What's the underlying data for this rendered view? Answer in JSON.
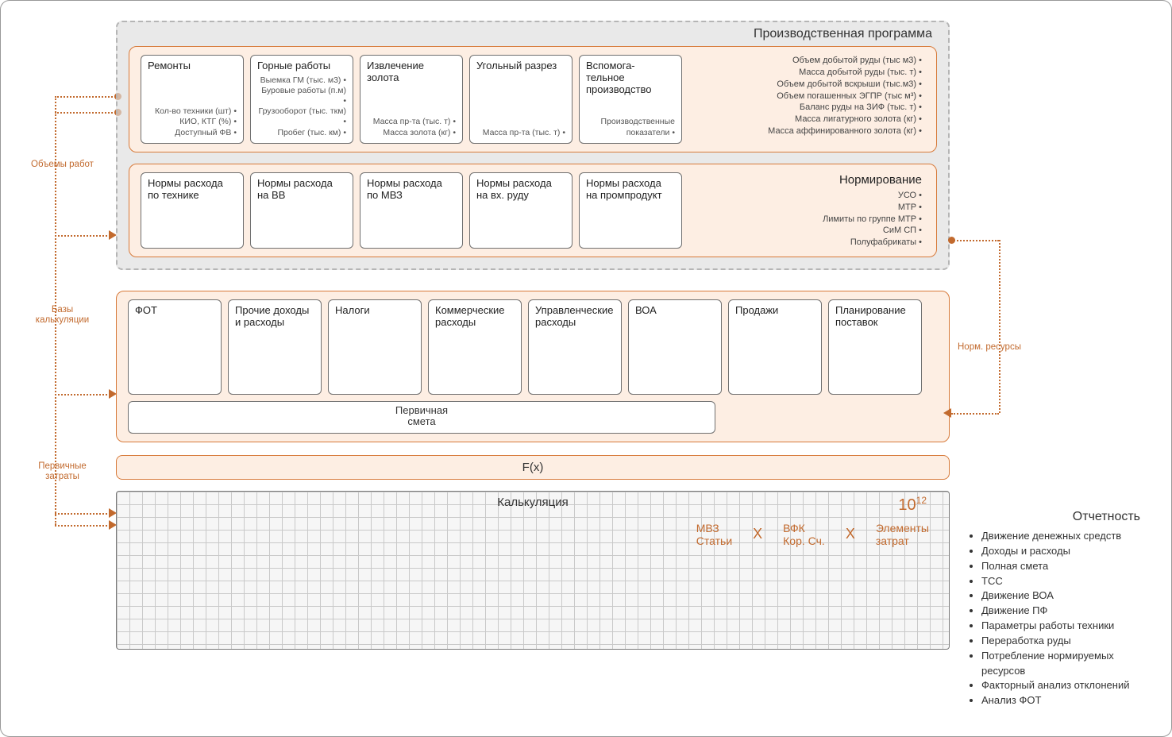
{
  "grey_title": "Производственная программа",
  "row1": {
    "cards": [
      {
        "title": "Ремонты",
        "bullets": [
          "Кол-во техники (шт)",
          "КИО, КТГ (%)",
          "Доступный ФВ"
        ]
      },
      {
        "title": "Горные работы",
        "bullets": [
          "Выемка ГМ (тыс. м3)",
          "Буровые работы (п.м)",
          "Грузооборот (тыс. ткм)",
          "Пробег (тыс. км)"
        ]
      },
      {
        "title": "Извлечение золота",
        "bullets": [
          "Масса пр-та (тыс. т)",
          "Масса золота (кг)"
        ]
      },
      {
        "title": "Угольный разрез",
        "bullets": [
          "Масса пр-та (тыс. т)"
        ]
      },
      {
        "title": "Вспомога-\nтельное производство",
        "bullets": [
          "Производственные показатели"
        ]
      }
    ],
    "aux": [
      "Объем добытой руды (тыс м3)",
      "Масса добытой руды (тыс. т)",
      "Объем добытой вскрыши (тыс.м3)",
      "Объем погашенных ЭГПР (тыс м³)",
      "Баланс руды на ЗИФ (тыс. т)",
      "Масса лигатурного золота (кг)",
      "Масса аффинированного золота (кг)"
    ]
  },
  "row2": {
    "cards": [
      {
        "title": "Нормы расхода по технике"
      },
      {
        "title": "Нормы расхода на ВВ"
      },
      {
        "title": "Нормы расхода по МВЗ"
      },
      {
        "title": "Нормы расхода на вх. руду"
      },
      {
        "title": "Нормы расхода на промпродукт"
      }
    ],
    "aux_title": "Нормирование",
    "aux": [
      "УСО",
      "МТР",
      "Лимиты по группе МТР",
      "СиМ СП",
      "Полуфабрикаты"
    ]
  },
  "row3": {
    "cards": [
      {
        "title": "ФОТ"
      },
      {
        "title": "Прочие доходы и расходы"
      },
      {
        "title": "Налоги"
      },
      {
        "title": "Коммерческие расходы"
      },
      {
        "title": "Управленческие расходы"
      },
      {
        "title": "ВОА"
      },
      {
        "title": "Продажи"
      },
      {
        "title": "Планирование поставок"
      }
    ],
    "primary_l1": "Первичная",
    "primary_l2": "смета"
  },
  "fx_label": "F(x)",
  "calc": {
    "title": "Калькуляция",
    "ten": "10",
    "exp": "12",
    "col1_l1": "МВЗ",
    "col1_l2": "Статьи",
    "col2_l1": "ВФК",
    "col2_l2": "Кор. Сч.",
    "col3_l1": "Элементы",
    "col3_l2": "затрат",
    "x": "X"
  },
  "labels": {
    "volumes": "Объемы работ",
    "bases_l1": "Базы",
    "bases_l2": "калькуляции",
    "primary_l1": "Первичные",
    "primary_l2": "затраты",
    "norm_res": "Норм. ресурсы"
  },
  "reporting": {
    "title": "Отчетность",
    "items": [
      "Движение денежных средств",
      "Доходы и расходы",
      "Полная смета",
      "TCC",
      "Движение ВОА",
      "Движение ПФ",
      "Параметры работы техники",
      "Переработка руды",
      "Потребление нормируемых ресурсов",
      "Факторный анализ отклонений",
      "Анализ ФОТ"
    ]
  }
}
